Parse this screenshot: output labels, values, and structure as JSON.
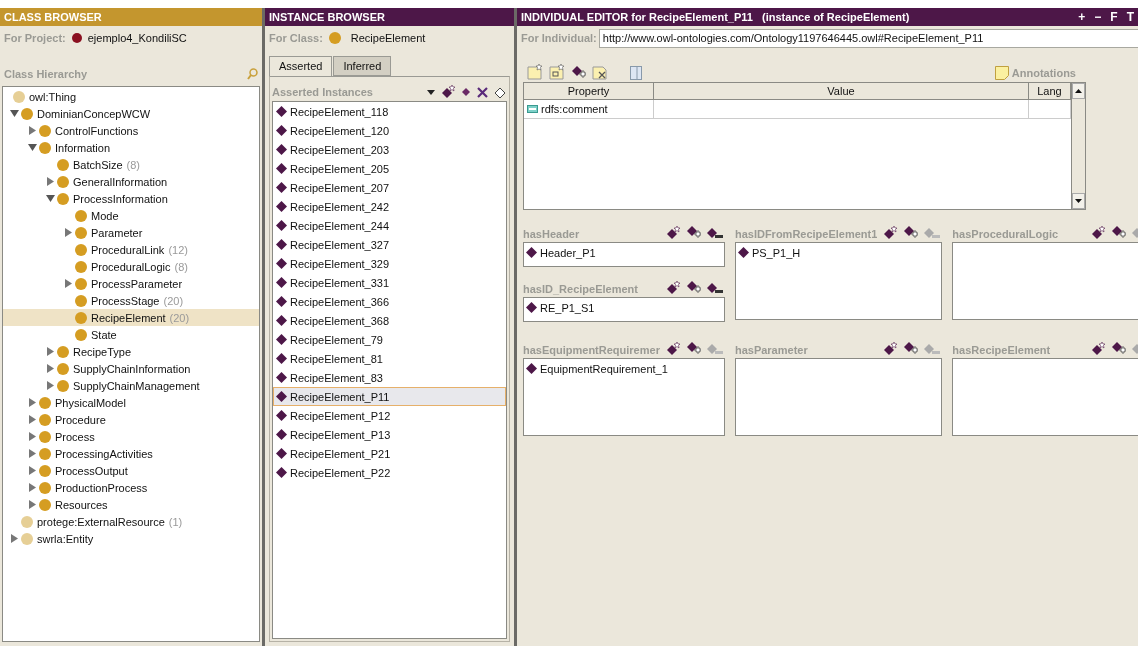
{
  "class_browser": {
    "title": "CLASS BROWSER",
    "project_label": "For Project:",
    "project_name": "ejemplo4_KondiliSC",
    "hierarchy_label": "Class Hierarchy",
    "root": {
      "name": "owl:Thing",
      "kind": "system",
      "selected": false,
      "children": [
        {
          "name": "DominianConcepWCW",
          "kind": "class",
          "selected": false,
          "expanded": true,
          "children": [
            {
              "name": "ControlFunctions",
              "kind": "class",
              "selected": false,
              "expanded": false
            },
            {
              "name": "Information",
              "kind": "class",
              "selected": false,
              "expanded": true,
              "children": [
                {
                  "name": "BatchSize",
                  "count": "(8)",
                  "kind": "class",
                  "selected": false
                },
                {
                  "name": "GeneralInformation",
                  "kind": "class",
                  "selected": false,
                  "expanded": false
                },
                {
                  "name": "ProcessInformation",
                  "kind": "class",
                  "selected": false,
                  "expanded": true,
                  "children": [
                    {
                      "name": "Mode",
                      "kind": "class",
                      "selected": false
                    },
                    {
                      "name": "Parameter",
                      "kind": "class",
                      "selected": false,
                      "expanded": false
                    },
                    {
                      "name": "ProceduralLink",
                      "count": "(12)",
                      "kind": "class",
                      "selected": false
                    },
                    {
                      "name": "ProceduralLogic",
                      "count": "(8)",
                      "kind": "class",
                      "selected": false
                    },
                    {
                      "name": "ProcessParameter",
                      "kind": "class",
                      "selected": false,
                      "expanded": false
                    },
                    {
                      "name": "ProcessStage",
                      "count": "(20)",
                      "kind": "class",
                      "selected": false
                    },
                    {
                      "name": "RecipeElement",
                      "count": "(20)",
                      "kind": "class",
                      "selected": true
                    },
                    {
                      "name": "State",
                      "kind": "class",
                      "selected": false
                    }
                  ]
                },
                {
                  "name": "RecipeType",
                  "kind": "class",
                  "selected": false,
                  "expanded": false
                },
                {
                  "name": "SupplyChainInformation",
                  "kind": "class",
                  "selected": false,
                  "expanded": false
                },
                {
                  "name": "SupplyChainManagement",
                  "kind": "class",
                  "selected": false,
                  "expanded": false
                }
              ]
            },
            {
              "name": "PhysicalModel",
              "kind": "class",
              "selected": false,
              "expanded": false
            },
            {
              "name": "Procedure",
              "kind": "class",
              "selected": false,
              "expanded": false
            },
            {
              "name": "Process",
              "kind": "class",
              "selected": false,
              "expanded": false
            },
            {
              "name": "ProcessingActivities",
              "kind": "class",
              "selected": false,
              "expanded": false
            },
            {
              "name": "ProcessOutput",
              "kind": "class",
              "selected": false,
              "expanded": false
            },
            {
              "name": "ProductionProcess",
              "kind": "class",
              "selected": false,
              "expanded": false
            },
            {
              "name": "Resources",
              "kind": "class",
              "selected": false,
              "expanded": false
            }
          ]
        },
        {
          "name": "protege:ExternalResource",
          "count": "(1)",
          "kind": "system",
          "selected": false
        },
        {
          "name": "swrla:Entity",
          "kind": "system",
          "selected": false,
          "expanded": false
        }
      ]
    }
  },
  "instance_browser": {
    "title": "INSTANCE BROWSER",
    "class_label": "For Class:",
    "class_name": "RecipeElement",
    "tabs": [
      {
        "label": "Asserted",
        "selected": true
      },
      {
        "label": "Inferred",
        "selected": false
      }
    ],
    "list_label": "Asserted Instances",
    "instances": [
      {
        "name": "RecipeElement_118",
        "selected": false
      },
      {
        "name": "RecipeElement_120",
        "selected": false
      },
      {
        "name": "RecipeElement_203",
        "selected": false
      },
      {
        "name": "RecipeElement_205",
        "selected": false
      },
      {
        "name": "RecipeElement_207",
        "selected": false
      },
      {
        "name": "RecipeElement_242",
        "selected": false
      },
      {
        "name": "RecipeElement_244",
        "selected": false
      },
      {
        "name": "RecipeElement_327",
        "selected": false
      },
      {
        "name": "RecipeElement_329",
        "selected": false
      },
      {
        "name": "RecipeElement_331",
        "selected": false
      },
      {
        "name": "RecipeElement_366",
        "selected": false
      },
      {
        "name": "RecipeElement_368",
        "selected": false
      },
      {
        "name": "RecipeElement_79",
        "selected": false
      },
      {
        "name": "RecipeElement_81",
        "selected": false
      },
      {
        "name": "RecipeElement_83",
        "selected": false
      },
      {
        "name": "RecipeElement_P11",
        "selected": true
      },
      {
        "name": "RecipeElement_P12",
        "selected": false
      },
      {
        "name": "RecipeElement_P13",
        "selected": false
      },
      {
        "name": "RecipeElement_P21",
        "selected": false
      },
      {
        "name": "RecipeElement_P22",
        "selected": false
      }
    ]
  },
  "individual_editor": {
    "title": "INDIVIDUAL EDITOR for RecipeElement_P11   (instance of RecipeElement)",
    "window_buttons": [
      "+",
      "−",
      "F",
      "T"
    ],
    "individual_label": "For Individual:",
    "individual_uri": "http://www.owl-ontologies.com/Ontology1197646445.owl#RecipeElement_P11",
    "annotations_label": "Annotations",
    "table": {
      "columns": [
        "Property",
        "Value",
        "Lang"
      ],
      "rows": [
        {
          "property": "rdfs:comment"
        }
      ]
    },
    "widgets": [
      {
        "kind": "stack",
        "items": [
          {
            "label": "hasHeader",
            "kind": "short",
            "remove_disabled": false,
            "values": [
              "Header_P1"
            ]
          },
          {
            "label": "hasID_RecipeElement",
            "kind": "short",
            "remove_disabled": false,
            "values": [
              "RE_P1_S1"
            ]
          }
        ]
      },
      {
        "label": "hasIDFromRecipeElement1",
        "kind": "tall",
        "remove_disabled": true,
        "values": [
          "PS_P1_H"
        ]
      },
      {
        "label": "hasProceduralLogic",
        "kind": "tall",
        "remove_disabled": true
      },
      {
        "label": "hasEquipmentRequiremer",
        "kind": "tall",
        "remove_disabled": true,
        "values": [
          "EquipmentRequirement_1"
        ]
      },
      {
        "label": "hasParameter",
        "kind": "tall",
        "remove_disabled": true
      },
      {
        "label": "hasRecipeElement",
        "kind": "tall",
        "remove_disabled": true
      }
    ]
  }
}
